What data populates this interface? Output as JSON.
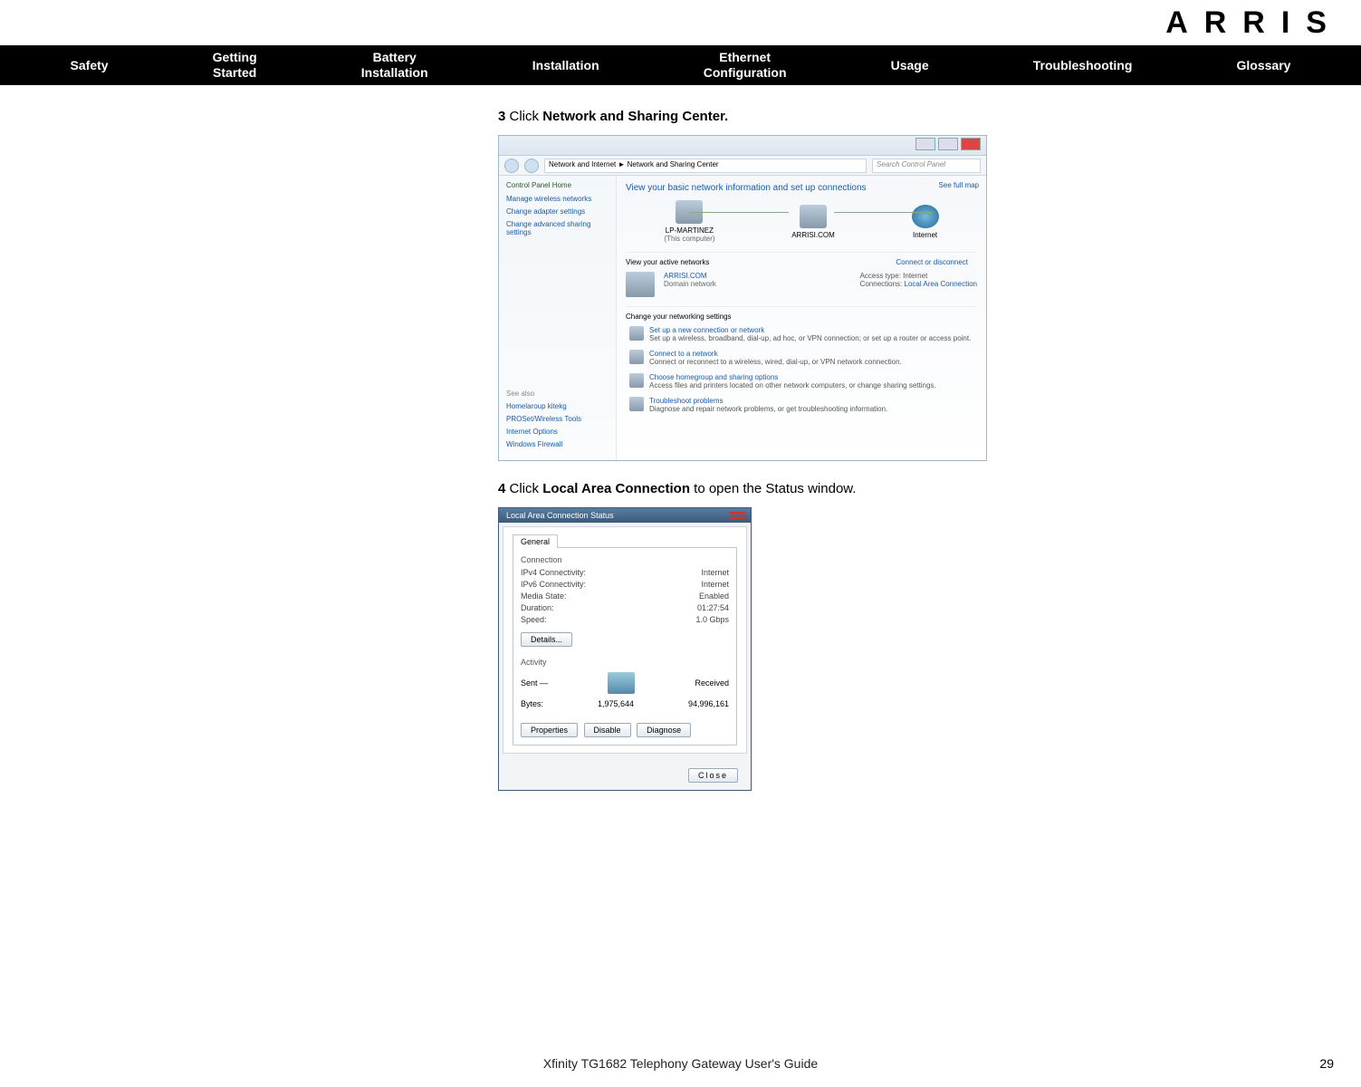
{
  "brand": "ARRIS",
  "nav": {
    "items": [
      "Safety",
      "Getting\nStarted",
      "Battery\nInstallation",
      "Installation",
      "Ethernet\nConfiguration",
      "Usage",
      "Troubleshooting",
      "Glossary"
    ]
  },
  "step3": {
    "num": "3",
    "text": "Click ",
    "bold": "Network and Sharing Center."
  },
  "step4": {
    "num": "4",
    "text": "Click ",
    "bold": "Local Area Connection",
    "tail": " to open the Status window."
  },
  "shot1": {
    "breadcrumb": "Network and Internet ► Network and Sharing Center",
    "search_placeholder": "Search Control Panel",
    "cp_home": "Control Panel Home",
    "left_links": [
      "Manage wireless networks",
      "Change adapter settings",
      "Change advanced sharing settings"
    ],
    "see_also_label": "See also",
    "see_also": [
      "Homelaroup kitekg",
      "PROSet/Wireless Tools",
      "Internet Options",
      "Windows Firewall"
    ],
    "main_heading": "View your basic network information and set up connections",
    "see_full_map": "See full map",
    "nodes": {
      "pc": "LP-MARTINEZ",
      "pc_sub": "(This computer)",
      "net": "ARRISI.COM",
      "inet": "Internet"
    },
    "active_label": "View your active networks",
    "connect_disconnect": "Connect or disconnect",
    "active": {
      "name": "ARRISI.COM",
      "type": "Domain network",
      "access_label": "Access type:",
      "access_value": "Internet",
      "conn_label": "Connections:",
      "conn_value": "Local Area Connection"
    },
    "change_heading": "Change your networking settings",
    "items": [
      {
        "title": "Set up a new connection or network",
        "desc": "Set up a wireless, broadband, dial-up, ad hoc, or VPN connection; or set up a router or access point."
      },
      {
        "title": "Connect to a network",
        "desc": "Connect or reconnect to a wireless, wired, dial-up, or VPN network connection."
      },
      {
        "title": "Choose homegroup and sharing options",
        "desc": "Access files and printers located on other network computers, or change sharing settings."
      },
      {
        "title": "Troubleshoot problems",
        "desc": "Diagnose and repair network problems, or get troubleshooting information."
      }
    ]
  },
  "shot2": {
    "title": "Local Area Connection Status",
    "tab": "General",
    "conn_label": "Connection",
    "rows": [
      {
        "k": "IPv4 Connectivity:",
        "v": "Internet"
      },
      {
        "k": "IPv6 Connectivity:",
        "v": "Internet"
      },
      {
        "k": "Media State:",
        "v": "Enabled"
      },
      {
        "k": "Duration:",
        "v": "01:27:54"
      },
      {
        "k": "Speed:",
        "v": "1.0 Gbps"
      }
    ],
    "details_btn": "Details...",
    "activity_label": "Activity",
    "sent_label": "Sent —",
    "received_label": "Received",
    "bytes_label": "Bytes:",
    "sent_bytes": "1,975,644",
    "recv_bytes": "94,996,161",
    "properties_btn": "Properties",
    "disable_btn": "Disable",
    "diagnose_btn": "Diagnose",
    "close_btn": "Close"
  },
  "footer": "Xfinity TG1682 Telephony Gateway User's Guide",
  "page": "29"
}
